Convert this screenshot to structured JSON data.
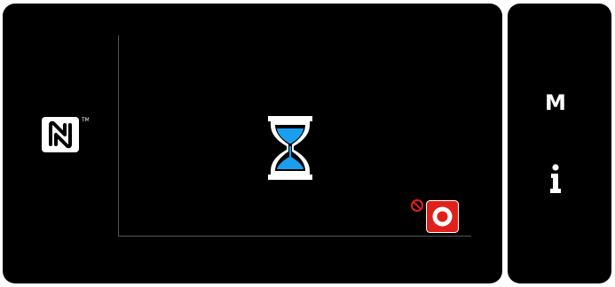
{
  "side_panel": {
    "mode_label": "M",
    "info_icon": "info-icon"
  },
  "main_panel": {
    "nfc_icon": "nfc-icon",
    "status_icon": "hourglass-icon",
    "no_entry_icon": "no-entry-icon",
    "stop_icon": "stop-record-icon"
  },
  "colors": {
    "background": "#000000",
    "hourglass_fill": "#1a9ff0",
    "stop_red": "#e0211b",
    "no_entry_red": "#e0211b"
  }
}
